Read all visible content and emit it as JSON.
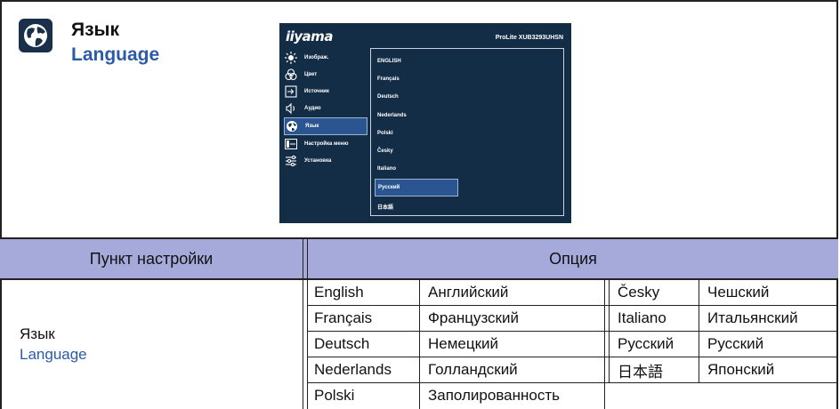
{
  "header": {
    "title_ru": "Язык",
    "title_en": "Language"
  },
  "osd": {
    "logo": "iiyama",
    "model": "ProLite XUB3293UHSN",
    "menu": [
      {
        "label": "Изображ.",
        "icon": "brightness-icon"
      },
      {
        "label": "Цвет",
        "icon": "color-icon"
      },
      {
        "label": "Источник",
        "icon": "input-icon"
      },
      {
        "label": "Аудио",
        "icon": "speaker-icon"
      },
      {
        "label": "Язык",
        "icon": "globe-icon",
        "selected": true
      },
      {
        "label": "Настройка меню",
        "icon": "menu-settings-icon"
      },
      {
        "label": "Установка",
        "icon": "setup-sliders-icon"
      }
    ],
    "languages": [
      "ENGLISH",
      "Français",
      "Deutsch",
      "Nederlands",
      "Polski",
      "Česky",
      "Italiano",
      "Русский",
      "日本語"
    ],
    "selected_language": "Русский"
  },
  "table": {
    "col_item": "Пункт настройки",
    "col_option": "Опция",
    "item_ru": "Язык",
    "item_en": "Language",
    "rows": [
      [
        "English",
        "Английский",
        "Česky",
        "Чешский"
      ],
      [
        "Français",
        "Французский",
        "Italiano",
        "Итальянский"
      ],
      [
        "Deutsch",
        "Немецкий",
        "Русский",
        "Русский"
      ],
      [
        "Nederlands",
        "Голландский",
        "日本語",
        "Японский"
      ],
      [
        "Polski",
        "Заполированность",
        "",
        ""
      ]
    ]
  },
  "colors": {
    "header_bg": "#a5aadb",
    "osd_bg": "#132d47",
    "accent_text": "#2a5aa8"
  }
}
